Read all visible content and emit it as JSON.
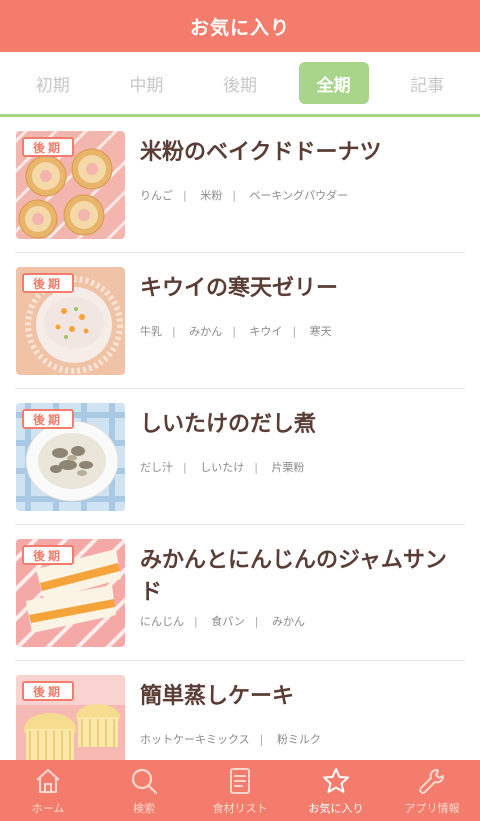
{
  "header": {
    "title": "お気に入り"
  },
  "tabs": [
    {
      "label": "初期"
    },
    {
      "label": "中期"
    },
    {
      "label": "後期"
    },
    {
      "label": "全期"
    },
    {
      "label": "記事"
    }
  ],
  "recipes": [
    {
      "badge": "後期",
      "title": "米粉のベイクドドーナツ",
      "tags": [
        "りんご",
        "米粉",
        "ベーキングパウダー"
      ]
    },
    {
      "badge": "後期",
      "title": "キウイの寒天ゼリー",
      "tags": [
        "牛乳",
        "みかん",
        "キウイ",
        "寒天"
      ]
    },
    {
      "badge": "後期",
      "title": "しいたけのだし煮",
      "tags": [
        "だし汁",
        "しいたけ",
        "片栗粉"
      ]
    },
    {
      "badge": "後期",
      "title": "みかんとにんじんのジャムサンド",
      "tags": [
        "にんじん",
        "食パン",
        "みかん"
      ]
    },
    {
      "badge": "後期",
      "title": "簡単蒸しケーキ",
      "tags": [
        "ホットケーキミックス",
        "粉ミルク"
      ]
    }
  ],
  "nav": [
    {
      "label": "ホーム",
      "icon": "home-icon"
    },
    {
      "label": "検索",
      "icon": "search-icon"
    },
    {
      "label": "食材リスト",
      "icon": "list-icon"
    },
    {
      "label": "お気に入り",
      "icon": "star-icon"
    },
    {
      "label": "アプリ情報",
      "icon": "info-icon"
    }
  ],
  "colors": {
    "accent": "#f47c6c",
    "tab_active": "#a8d58a",
    "text": "#5a3e36"
  }
}
